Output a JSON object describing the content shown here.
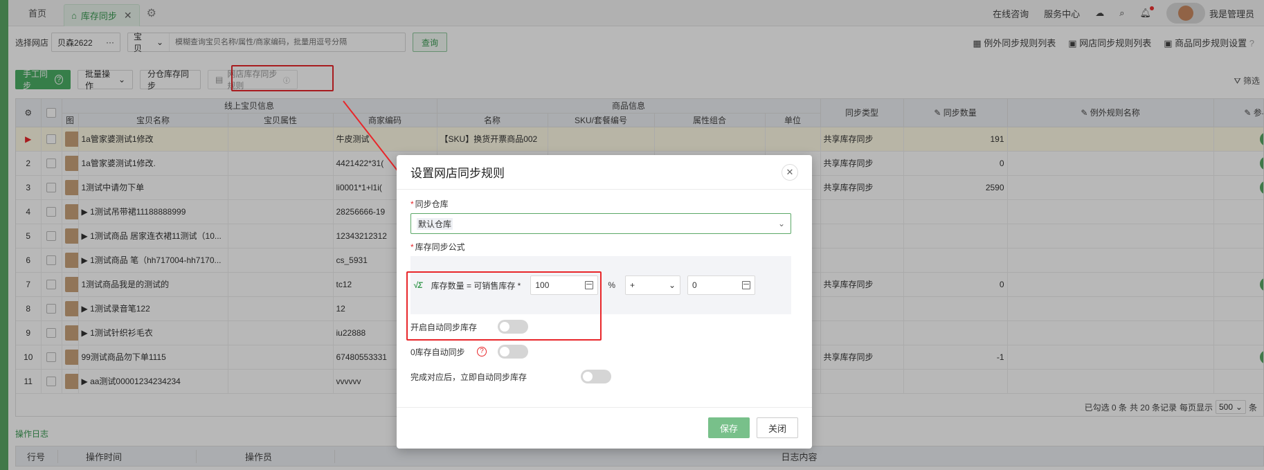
{
  "topbar": {
    "home_tab": "首页",
    "active_tab": "库存同步",
    "online_consult": "在线咨询",
    "service_center": "服务中心",
    "user": "我是管理员"
  },
  "search": {
    "shop_label": "选择网店",
    "shop_value": "贝森2622",
    "shop_more": "···",
    "type_value": "宝贝",
    "placeholder": "模糊查询宝贝名称/属性/商家编码，批量用逗号分隔",
    "query_button": "查询",
    "links": [
      "例外同步规则列表",
      "网店同步规则列表",
      "商品同步规则设置"
    ]
  },
  "toolbar": {
    "manual_sync": "手工同步",
    "batch_ops": "批量操作",
    "warehouse_sync": "分仓库存同步",
    "shop_rules": "网店库存同步规则",
    "filter": "筛选"
  },
  "table": {
    "group_headers": {
      "online": "线上宝贝信息",
      "goods": "商品信息"
    },
    "headers": {
      "img": "图",
      "name": "宝贝名称",
      "attr": "宝贝属性",
      "code": "商家编码",
      "goods_name": "名称",
      "sku": "SKU/套餐编号",
      "combo": "属性组合",
      "unit": "单位",
      "sync_type": "同步类型",
      "sync_qty": "同步数量",
      "exception_rule": "例外规则名称",
      "auto_sync": "参与自动同步"
    },
    "rows": [
      {
        "no": "▶",
        "name": "1a管家婆测试1修改",
        "code": "牛皮测试",
        "goods": "【SKU】换货开票商品002",
        "type": "共享库存同步",
        "qty": "191",
        "toggle": true
      },
      {
        "no": "2",
        "name": "1a管家婆测试1修改.",
        "code": "4421422*31(",
        "goods": "",
        "type": "共享库存同步",
        "qty": "0",
        "toggle": true
      },
      {
        "no": "3",
        "name": "1测试中请勿下单",
        "code": "li0001*1+l1i(",
        "goods": "",
        "type": "共享库存同步",
        "qty": "2590",
        "toggle": true
      },
      {
        "no": "4",
        "name": "▶ 1测试吊带裙11188888999",
        "code": "28256666-19",
        "goods": "",
        "type": "",
        "qty": "",
        "toggle": false
      },
      {
        "no": "5",
        "name": "▶ 1测试商品 居家连衣裙11测试（10...",
        "code": "12343212312",
        "goods": "",
        "type": "",
        "qty": "",
        "toggle": false
      },
      {
        "no": "6",
        "name": "▶ 1测试商品 笔（hh717004-hh7170...",
        "code": "cs_5931",
        "goods": "",
        "type": "",
        "qty": "",
        "toggle": false
      },
      {
        "no": "7",
        "name": "1测试商品我是的测试的",
        "code": "tc12",
        "goods": "",
        "type": "共享库存同步",
        "qty": "0",
        "toggle": true
      },
      {
        "no": "8",
        "name": "▶ 1测试录音笔122",
        "code": "12",
        "goods": "",
        "type": "",
        "qty": "",
        "toggle": false
      },
      {
        "no": "9",
        "name": "▶ 1测试针织衫毛衣",
        "code": "iu22888",
        "goods": "",
        "type": "",
        "qty": "",
        "toggle": false
      },
      {
        "no": "10",
        "name": "99测试商品勿下单1115",
        "code": "67480553331",
        "goods": "",
        "type": "共享库存同步",
        "qty": "-1",
        "toggle": true
      },
      {
        "no": "11",
        "name": "▶ aa测试00001234234234",
        "code": "vvvvvv",
        "goods": "",
        "type": "",
        "qty": "",
        "toggle": false
      }
    ]
  },
  "pagination": {
    "selected": "已勾选 0 条",
    "total": "共 20 条记录",
    "per_page_label": "每页显示",
    "per_page": "500",
    "unit": "条"
  },
  "log": {
    "title": "操作日志",
    "headers": [
      "行号",
      "操作时间",
      "操作员",
      "日志内容"
    ]
  },
  "modal": {
    "title": "设置网店同步规则",
    "warehouse_label": "同步仓库",
    "warehouse_value": "默认仓库",
    "formula_label": "库存同步公式",
    "formula_text": "库存数量 = 可销售库存 *",
    "percent_value": "100",
    "percent_sign": "%",
    "operator": "+",
    "offset_value": "0",
    "switches": [
      {
        "label": "开启自动同步库存",
        "on": false
      },
      {
        "label": "0库存自动同步",
        "on": false,
        "help": true
      },
      {
        "label": "完成对应后，立即自动同步库存",
        "on": false
      }
    ],
    "save": "保存",
    "close": "关闭"
  }
}
